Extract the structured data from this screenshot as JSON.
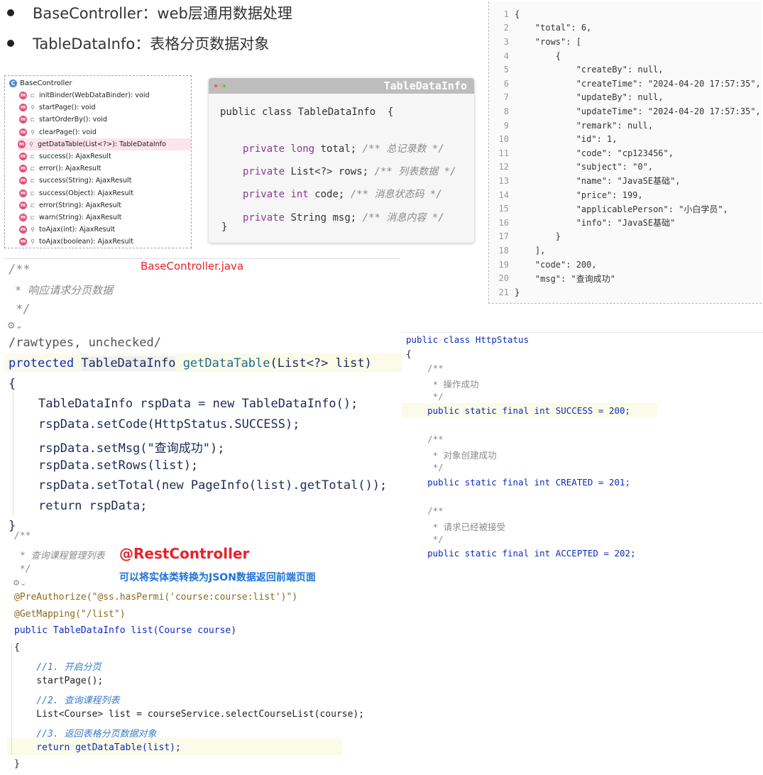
{
  "bullets": [
    {
      "text": "BaseController：web层通用数据处理"
    },
    {
      "text": "TableDataInfo：表格分页数据对象"
    }
  ],
  "method_tree": {
    "root": "BaseController",
    "methods": [
      "initBinder(WebDataBinder): void",
      "startPage(): void",
      "startOrderBy(): void",
      "clearPage(): void",
      "getDataTable(List<?>): TableDataInfo",
      "success(): AjaxResult",
      "error(): AjaxResult",
      "success(String): AjaxResult",
      "success(Object): AjaxResult",
      "error(String): AjaxResult",
      "warn(String): AjaxResult",
      "toAjax(int): AjaxResult",
      "toAjax(boolean): AjaxResult"
    ],
    "highlighted_index": 4
  },
  "table_data_info": {
    "title": "TableDataInfo",
    "class_line": "public class TableDataInfo  {",
    "fields": [
      {
        "kw": "private",
        "type": "long",
        "name": "total;",
        "comment": "/** 总记录数 */"
      },
      {
        "kw": "private",
        "type": "List<?>",
        "name": "rows;",
        "comment": "/** 列表数据 */"
      },
      {
        "kw": "private",
        "type": "int",
        "name": "code;",
        "comment": "/** 消息状态码 */"
      },
      {
        "kw": "private",
        "type": "String",
        "name": "msg;",
        "comment": "/** 消息内容 */"
      }
    ],
    "closing": "}"
  },
  "json_panel": {
    "lines": [
      "{",
      "    \"total\": 6,",
      "    \"rows\": [",
      "        {",
      "            \"createBy\": null,",
      "            \"createTime\": \"2024-04-20 17:57:35\",",
      "            \"updateBy\": null,",
      "            \"updateTime\": \"2024-04-20 17:57:35\",",
      "            \"remark\": null,",
      "            \"id\": 1,",
      "            \"code\": \"cp123456\",",
      "            \"subject\": \"0\",",
      "            \"name\": \"JavaSE基础\",",
      "            \"price\": 199,",
      "            \"applicablePerson\": \"小白学员\",",
      "            \"info\": \"JavaSE基础\"",
      "        }",
      "    ],",
      "    \"code\": 200,",
      "    \"msg\": \"查询成功\"",
      "}"
    ]
  },
  "base_controller": {
    "file_label": "BaseController.java",
    "doc": [
      "/**",
      " * 响应请求分页数据",
      " */"
    ],
    "suppress": "/rawtypes, unchecked/",
    "signature": {
      "kw": "protected",
      "type": "TableDataInfo",
      "name": "getDataTable",
      "params": "(List<?> list)"
    },
    "open": "{",
    "body": [
      "TableDataInfo rspData = new TableDataInfo();",
      "rspData.setCode(HttpStatus.SUCCESS);",
      "rspData.setMsg(\"查询成功\");",
      "rspData.setRows(list);",
      "rspData.setTotal(new PageInfo(list).getTotal());",
      "return rspData;"
    ],
    "close": "}"
  },
  "http_status": {
    "lines": [
      "public class HttpStatus",
      "{",
      "    /**",
      "     * 操作成功",
      "     */",
      "    public static final int SUCCESS = 200;",
      "",
      "    /**",
      "     * 对象创建成功",
      "     */",
      "    public static final int CREATED = 201;",
      "",
      "    /**",
      "     * 请求已经被接受",
      "     */",
      "    public static final int ACCEPTED = 202;"
    ]
  },
  "rest_controller": {
    "title": "@RestController",
    "subtitle": "可以将实体类转换为JSON数据返回前端页面"
  },
  "course_list": {
    "lines": [
      "/**",
      " * 查询课程管理列表",
      " */",
      "@PreAuthorize(\"@ss.hasPermi('course:course:list')\")",
      "@GetMapping(\"/list\")",
      "public TableDataInfo list(Course course)",
      "{",
      "    //1. 开启分页",
      "    startPage();",
      "    //2. 查询课程列表",
      "    List<Course> list = courseService.selectCourseList(course);",
      "    //3. 返回表格分页数据对象",
      "    return getDataTable(list);",
      "}"
    ]
  },
  "colors": {
    "keyword": "#0d2bbd",
    "comment": "#8a8a8a",
    "json_key": "#8c3b8e",
    "json_string": "#a86f1d",
    "rest_controller_title": "#e8232b",
    "rest_controller_subtitle": "#1e73d8"
  }
}
